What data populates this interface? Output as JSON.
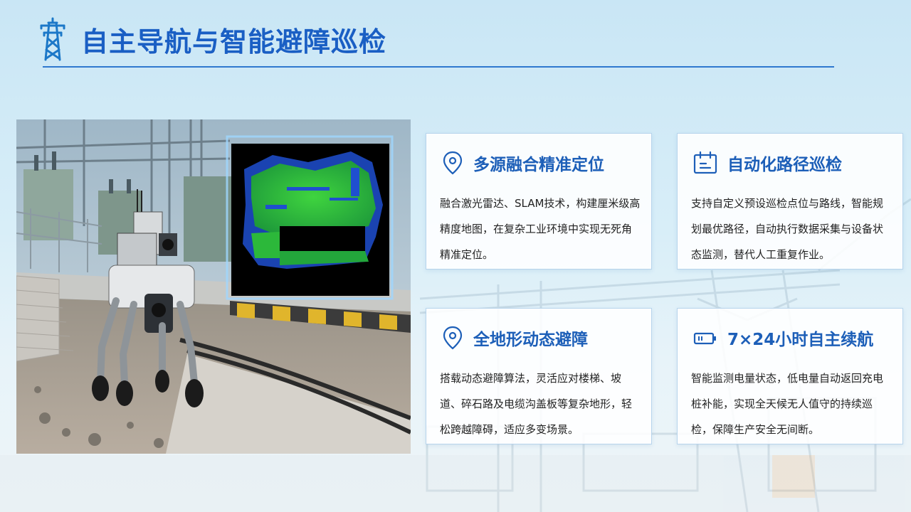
{
  "header": {
    "title": "自主导航与智能避障巡检"
  },
  "cards": [
    {
      "title": "多源融合精准定位",
      "icon": "location-pin-icon",
      "text": "融合激光雷达、SLAM技术，构建厘米级高精度地图，在复杂工业环境中实现无死角精准定位。"
    },
    {
      "title": "自动化路径巡检",
      "icon": "calendar-icon",
      "text": "支持自定义预设巡检点位与路线，智能规划最优路径，自动执行数据采集与设备状态监测，替代人工重复作业。"
    },
    {
      "title": "全地形动态避障",
      "icon": "location-pin-icon",
      "text": "搭载动态避障算法，灵活应对楼梯、坡道、碎石路及电缆沟盖板等复杂地形，轻松跨越障碍，适应多变场景。"
    },
    {
      "title": "7×24小时自主续航",
      "icon": "battery-icon",
      "text": "智能监测电量状态，低电量自动返回充电桩补能，实现全天候无人值守的持续巡检，保障生产安全无间断。"
    }
  ],
  "colors": {
    "accent": "#1a5fc4",
    "card_title": "#1d5fb8",
    "point_cloud": "#33c633"
  }
}
